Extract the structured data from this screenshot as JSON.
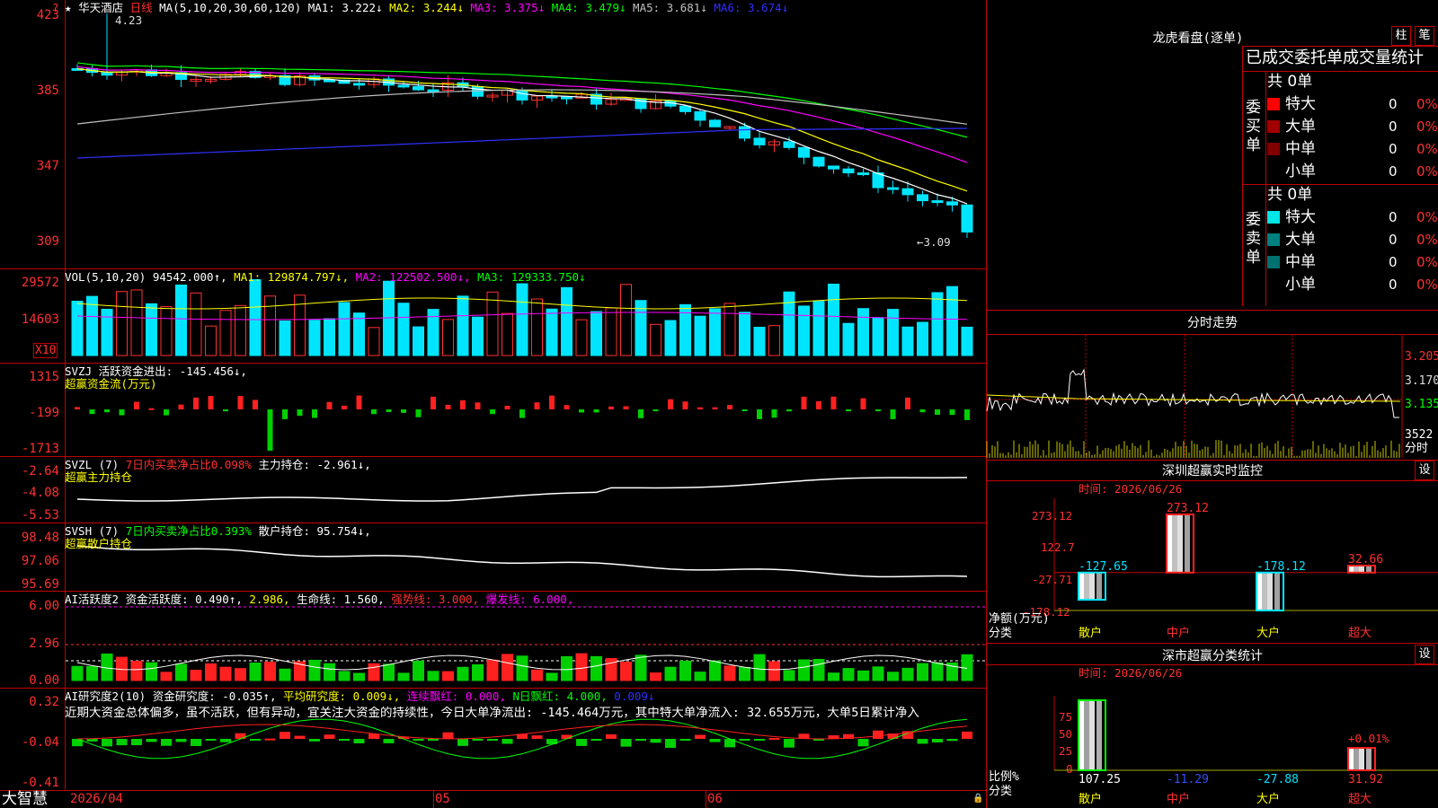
{
  "header": {
    "star": "★",
    "stock_name": "华天酒店",
    "period": "日线",
    "ma_label": "MA(5,10,20,30,60,120)",
    "ma1": "MA1: 3.222↓",
    "ma2": "MA2: 3.244↓",
    "ma3": "MA3: 3.375↓",
    "ma4": "MA4: 3.479↓",
    "ma5": "MA5: 3.681↓",
    "ma6": "MA6: 3.674↓",
    "colors": {
      "ma1": "#ffffff",
      "ma2": "#ffff00",
      "ma3": "#ff00ff",
      "ma4": "#00ff00",
      "ma5": "#c0c0c0",
      "ma6": "#2020ff"
    }
  },
  "price_panel": {
    "axis": [
      "423",
      "385",
      "347",
      "309"
    ],
    "high_mark": "4.23",
    "low_mark": "←3.09",
    "corner_question": "?"
  },
  "vol_panel": {
    "label": "VOL(5,10,20)",
    "value": "94542.000↑,",
    "ma1": "MA1: 129874.797↓,",
    "ma2": "MA2: 122502.500↓,",
    "ma3": "MA3: 129333.750↓",
    "axis": [
      "29572",
      "14603"
    ],
    "unit": "X10"
  },
  "svzj_panel": {
    "label": "SVZJ",
    "title": "活跃资金进出: -145.456↓,",
    "sub": "超赢资金流(万元)",
    "axis": [
      "1315",
      "-199",
      "-1713"
    ]
  },
  "svzl_panel": {
    "label": "SVZL (7)",
    "ratio": "7日内买卖净占比0.098%",
    "holding": "主力持仓: -2.961↓,",
    "sub": "超赢主力持仓",
    "axis": [
      "-2.64",
      "-4.08",
      "-5.53"
    ]
  },
  "svsh_panel": {
    "label": "SVSH (7)",
    "ratio": "7日内买卖净占比0.393%",
    "holding": "散户持仓: 95.754↓,",
    "sub": "超赢散户持仓",
    "axis": [
      "98.48",
      "97.06",
      "95.69"
    ]
  },
  "ai_active_panel": {
    "label": "AI活跃度2",
    "active": "资金活跃度: 0.490↑,",
    "v2": "2.986,",
    "life": "生命线: 1.560,",
    "strong": "强势线: 3.000,",
    "burst": "爆发线: 6.000,",
    "axis": [
      "6.00",
      "2.96",
      "0.00"
    ]
  },
  "ai_research_panel": {
    "label": "AI研究度2(10)",
    "research": "资金研究度: -0.035↑,",
    "avg": "平均研究度: 0.009↓,",
    "cont": "连续飘红: 0.000,",
    "nday": "N日飘红: 4.000,",
    "last": "0.009↓",
    "comment": "近期大资金总体偏多，虽不活跃，但有异动，宜关注大资金的持续性，今日大单净流出: -145.464万元，其中特大单净流入: 32.655万元，大单5日累计净入",
    "axis": [
      "0.32",
      "-0.04",
      "-0.41"
    ]
  },
  "bottom_bar": {
    "brand": "大智慧",
    "date_start": "2026/04",
    "m05": "05",
    "m06": "06",
    "lock": "🔒"
  },
  "right": {
    "dragon_title": "龙虎看盘(逐单)",
    "btn_zhu": "柱",
    "btn_bi": "笔",
    "stats_title": "已成交委托单成交量统计",
    "buy_side": "委买单",
    "sell_side": "委卖单",
    "buy_total": "共 0单",
    "sell_total": "共 0单",
    "buy_rows": [
      {
        "name": "特大",
        "val": "0",
        "pct": "0%",
        "color": "#ff0000"
      },
      {
        "name": "大单",
        "val": "0",
        "pct": "0%",
        "color": "#a00000"
      },
      {
        "name": "中单",
        "val": "0",
        "pct": "0%",
        "color": "#800000"
      },
      {
        "name": "小单",
        "val": "0",
        "pct": "0%",
        "color": "#000000"
      }
    ],
    "sell_rows": [
      {
        "name": "特大",
        "val": "0",
        "pct": "0%",
        "color": "#00e5e5"
      },
      {
        "name": "大单",
        "val": "0",
        "pct": "0%",
        "color": "#008080"
      },
      {
        "name": "中单",
        "val": "0",
        "pct": "0%",
        "color": "#007070"
      },
      {
        "name": "小单",
        "val": "0",
        "pct": "0%",
        "color": "#000000"
      }
    ],
    "intraday_title": "分时走势",
    "intraday_axis": [
      "3.205",
      "3.170",
      "3.135"
    ],
    "intraday_vol": "3522",
    "intraday_unit": "分时",
    "monitor_title": "深圳超赢实时监控",
    "monitor_btn": "设",
    "monitor_time": "时间: 2026/06/26",
    "monitor_axis": [
      "273.12",
      "122.7",
      "-27.71",
      "-178.12"
    ],
    "monitor_y_label": "净额(万元)",
    "monitor_x_label": "分类",
    "stat_title": "深市超赢分类统计",
    "stat_btn": "设",
    "stat_time": "时间: 2026/06/26",
    "stat_axis": [
      "75",
      "50",
      "25",
      "0"
    ],
    "stat_y_label": "比例%",
    "stat_x_label": "分类",
    "stat_pct_label": "+0.01%",
    "categories": [
      "散户",
      "中户",
      "大户",
      "超大"
    ]
  },
  "chart_data": [
    {
      "type": "bar",
      "title": "深圳超赢实时监控",
      "categories": [
        "散户",
        "中户",
        "大户",
        "超大"
      ],
      "values": [
        -127.65,
        273.12,
        -178.12,
        32.66
      ],
      "value_labels": [
        "-127.65",
        "273.12",
        "-178.12",
        "32.66"
      ],
      "ylabel": "净额(万元)",
      "xlabel": "分类",
      "ylim": [
        -178.12,
        273.12
      ]
    },
    {
      "type": "bar",
      "title": "深市超赢分类统计",
      "categories": [
        "散户",
        "中户",
        "大户",
        "超大"
      ],
      "values": [
        107.25,
        -11.29,
        -27.88,
        31.92
      ],
      "value_labels": [
        "107.25",
        "-11.29",
        "-27.88",
        "31.92"
      ],
      "ylabel": "比例%",
      "xlabel": "分类",
      "ylim": [
        0,
        100
      ]
    }
  ]
}
